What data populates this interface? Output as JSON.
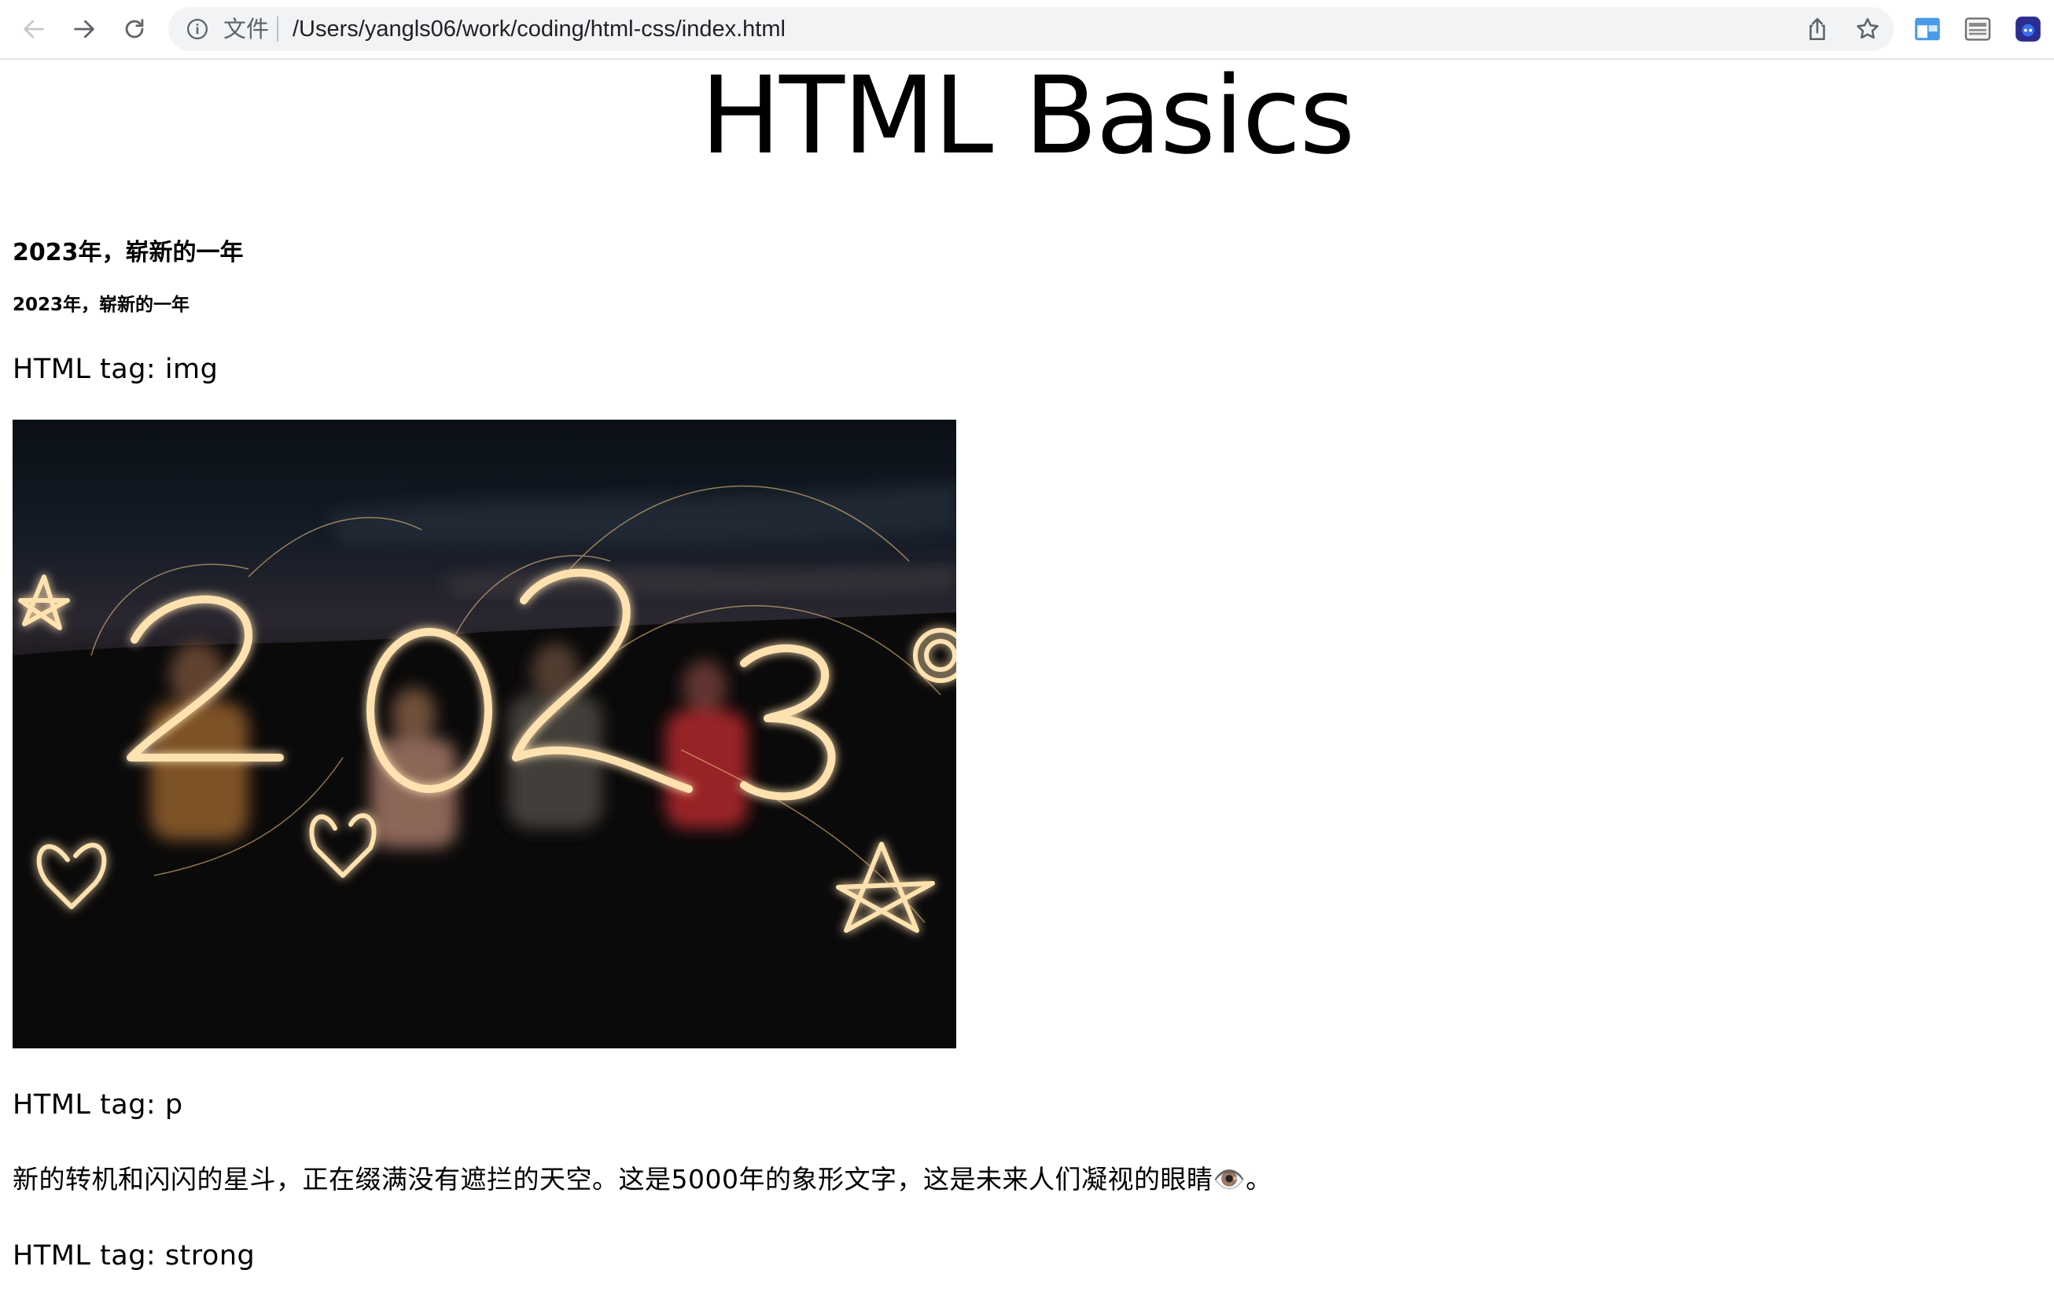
{
  "browser": {
    "address_scheme_label": "文件",
    "address_url": "/Users/yangls06/work/coding/html-css/index.html"
  },
  "page": {
    "h1": "HTML Basics",
    "h3": "2023年，崭新的一年",
    "h5": "2023年，崭新的一年",
    "img_caption": "HTML tag: img",
    "image": {
      "description_icon": "photo-2023-sparklers",
      "sparkler_text": "2023"
    },
    "p_caption": "HTML tag: p",
    "paragraph": "新的转机和闪闪的星斗，正在缀满没有遮拦的天空。这是5000年的象形文字，这是未来人们凝视的眼睛👁️。",
    "strong_caption": "HTML tag: strong"
  },
  "colors": {
    "omnibox_bg": "#f1f3f4",
    "icon_gray": "#5f6368",
    "ext_blue": "#1a73e8",
    "ext_navy": "#2b2d8f",
    "sparkle": "#ffd8a0"
  }
}
